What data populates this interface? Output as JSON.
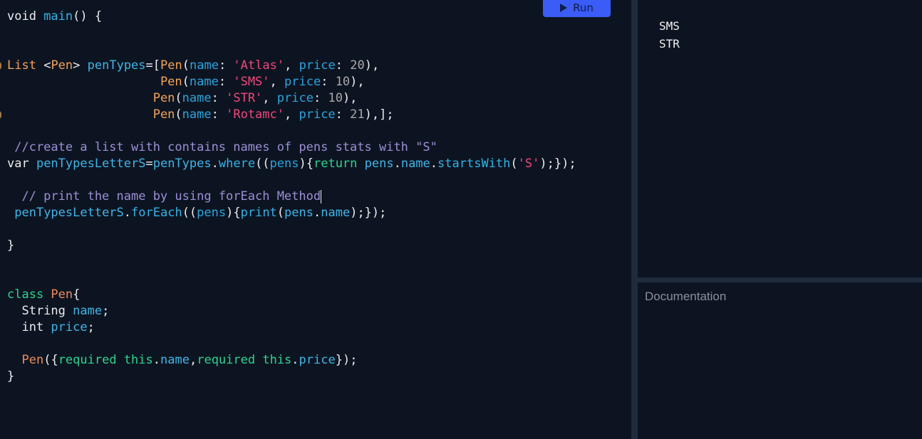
{
  "toolbar": {
    "run_label": "Run",
    "run_icon": "play-icon"
  },
  "editor": {
    "lines": [
      [
        {
          "t": "void ",
          "c": ""
        },
        {
          "t": "main",
          "c": "fn"
        },
        {
          "t": "() {",
          "c": ""
        }
      ],
      [],
      [],
      [
        {
          "t": "List ",
          "c": "kw-type"
        },
        {
          "t": "<",
          "c": ""
        },
        {
          "t": "Pen",
          "c": "kw-type"
        },
        {
          "t": "> ",
          "c": ""
        },
        {
          "t": "penTypes",
          "c": "ident"
        },
        {
          "t": "=[",
          "c": ""
        },
        {
          "t": "Pen",
          "c": "kw-type"
        },
        {
          "t": "(",
          "c": ""
        },
        {
          "t": "name",
          "c": "param"
        },
        {
          "t": ": ",
          "c": ""
        },
        {
          "t": "'Atlas'",
          "c": "str"
        },
        {
          "t": ", ",
          "c": ""
        },
        {
          "t": "price",
          "c": "param"
        },
        {
          "t": ": ",
          "c": ""
        },
        {
          "t": "20",
          "c": "num"
        },
        {
          "t": "),",
          "c": ""
        }
      ],
      [
        {
          "t": "                     ",
          "c": ""
        },
        {
          "t": "Pen",
          "c": "kw-type"
        },
        {
          "t": "(",
          "c": ""
        },
        {
          "t": "name",
          "c": "param"
        },
        {
          "t": ": ",
          "c": ""
        },
        {
          "t": "'SMS'",
          "c": "str"
        },
        {
          "t": ", ",
          "c": ""
        },
        {
          "t": "price",
          "c": "param"
        },
        {
          "t": ": ",
          "c": ""
        },
        {
          "t": "10",
          "c": "num"
        },
        {
          "t": "),",
          "c": ""
        }
      ],
      [
        {
          "t": "                    ",
          "c": ""
        },
        {
          "t": "Pen",
          "c": "kw-type"
        },
        {
          "t": "(",
          "c": ""
        },
        {
          "t": "name",
          "c": "param"
        },
        {
          "t": ": ",
          "c": ""
        },
        {
          "t": "'STR'",
          "c": "str"
        },
        {
          "t": ", ",
          "c": ""
        },
        {
          "t": "price",
          "c": "param"
        },
        {
          "t": ": ",
          "c": ""
        },
        {
          "t": "10",
          "c": "num"
        },
        {
          "t": "),",
          "c": ""
        }
      ],
      [
        {
          "t": "                    ",
          "c": ""
        },
        {
          "t": "Pen",
          "c": "kw-type"
        },
        {
          "t": "(",
          "c": ""
        },
        {
          "t": "name",
          "c": "param"
        },
        {
          "t": ": ",
          "c": ""
        },
        {
          "t": "'Rotamc'",
          "c": "str"
        },
        {
          "t": ", ",
          "c": ""
        },
        {
          "t": "price",
          "c": "param"
        },
        {
          "t": ": ",
          "c": ""
        },
        {
          "t": "21",
          "c": "num"
        },
        {
          "t": "),];",
          "c": ""
        }
      ],
      [],
      [
        {
          "t": " //create a list with contains names of pens stats with \"S\"",
          "c": "comment"
        }
      ],
      [
        {
          "t": "var ",
          "c": ""
        },
        {
          "t": "penTypesLetterS",
          "c": "ident"
        },
        {
          "t": "=",
          "c": ""
        },
        {
          "t": "penTypes",
          "c": "ident"
        },
        {
          "t": ".",
          "c": ""
        },
        {
          "t": "where",
          "c": "fn"
        },
        {
          "t": "((",
          "c": ""
        },
        {
          "t": "pens",
          "c": "param"
        },
        {
          "t": "){",
          "c": ""
        },
        {
          "t": "return ",
          "c": "ctrl"
        },
        {
          "t": "pens",
          "c": "ident"
        },
        {
          "t": ".",
          "c": ""
        },
        {
          "t": "name",
          "c": "ident"
        },
        {
          "t": ".",
          "c": ""
        },
        {
          "t": "startsWith",
          "c": "fn"
        },
        {
          "t": "(",
          "c": ""
        },
        {
          "t": "'S'",
          "c": "str"
        },
        {
          "t": ");});",
          "c": ""
        }
      ],
      [],
      [
        {
          "t": "  // print the name by using forEach Method",
          "c": "comment"
        },
        {
          "t": "",
          "c": "caret"
        }
      ],
      [
        {
          "t": " ",
          "c": ""
        },
        {
          "t": "penTypesLetterS",
          "c": "ident"
        },
        {
          "t": ".",
          "c": ""
        },
        {
          "t": "forEach",
          "c": "fn"
        },
        {
          "t": "((",
          "c": ""
        },
        {
          "t": "pens",
          "c": "param"
        },
        {
          "t": "){",
          "c": ""
        },
        {
          "t": "print",
          "c": "fn"
        },
        {
          "t": "(",
          "c": ""
        },
        {
          "t": "pens",
          "c": "ident"
        },
        {
          "t": ".",
          "c": ""
        },
        {
          "t": "name",
          "c": "ident"
        },
        {
          "t": ");});",
          "c": ""
        }
      ],
      [],
      [
        {
          "t": "}",
          "c": ""
        }
      ],
      [],
      [],
      [
        {
          "t": "class ",
          "c": "ctrl"
        },
        {
          "t": "Pen",
          "c": "kw-class"
        },
        {
          "t": "{",
          "c": ""
        }
      ],
      [
        {
          "t": "  String ",
          "c": ""
        },
        {
          "t": "name",
          "c": "ident"
        },
        {
          "t": ";",
          "c": ""
        }
      ],
      [
        {
          "t": "  int ",
          "c": ""
        },
        {
          "t": "price",
          "c": "ident"
        },
        {
          "t": ";",
          "c": ""
        }
      ],
      [],
      [
        {
          "t": "  ",
          "c": ""
        },
        {
          "t": "Pen",
          "c": "kw-class"
        },
        {
          "t": "({",
          "c": ""
        },
        {
          "t": "required ",
          "c": "ctrl"
        },
        {
          "t": "this",
          "c": "ctrl"
        },
        {
          "t": ".",
          "c": ""
        },
        {
          "t": "name",
          "c": "ident"
        },
        {
          "t": ",",
          "c": ""
        },
        {
          "t": "required ",
          "c": "ctrl"
        },
        {
          "t": "this",
          "c": "ctrl"
        },
        {
          "t": ".",
          "c": ""
        },
        {
          "t": "price",
          "c": "ident"
        },
        {
          "t": "});",
          "c": ""
        }
      ],
      [
        {
          "t": "}",
          "c": ""
        }
      ]
    ]
  },
  "console": {
    "lines": [
      "SMS",
      "STR"
    ]
  },
  "docs": {
    "title": "Documentation"
  }
}
